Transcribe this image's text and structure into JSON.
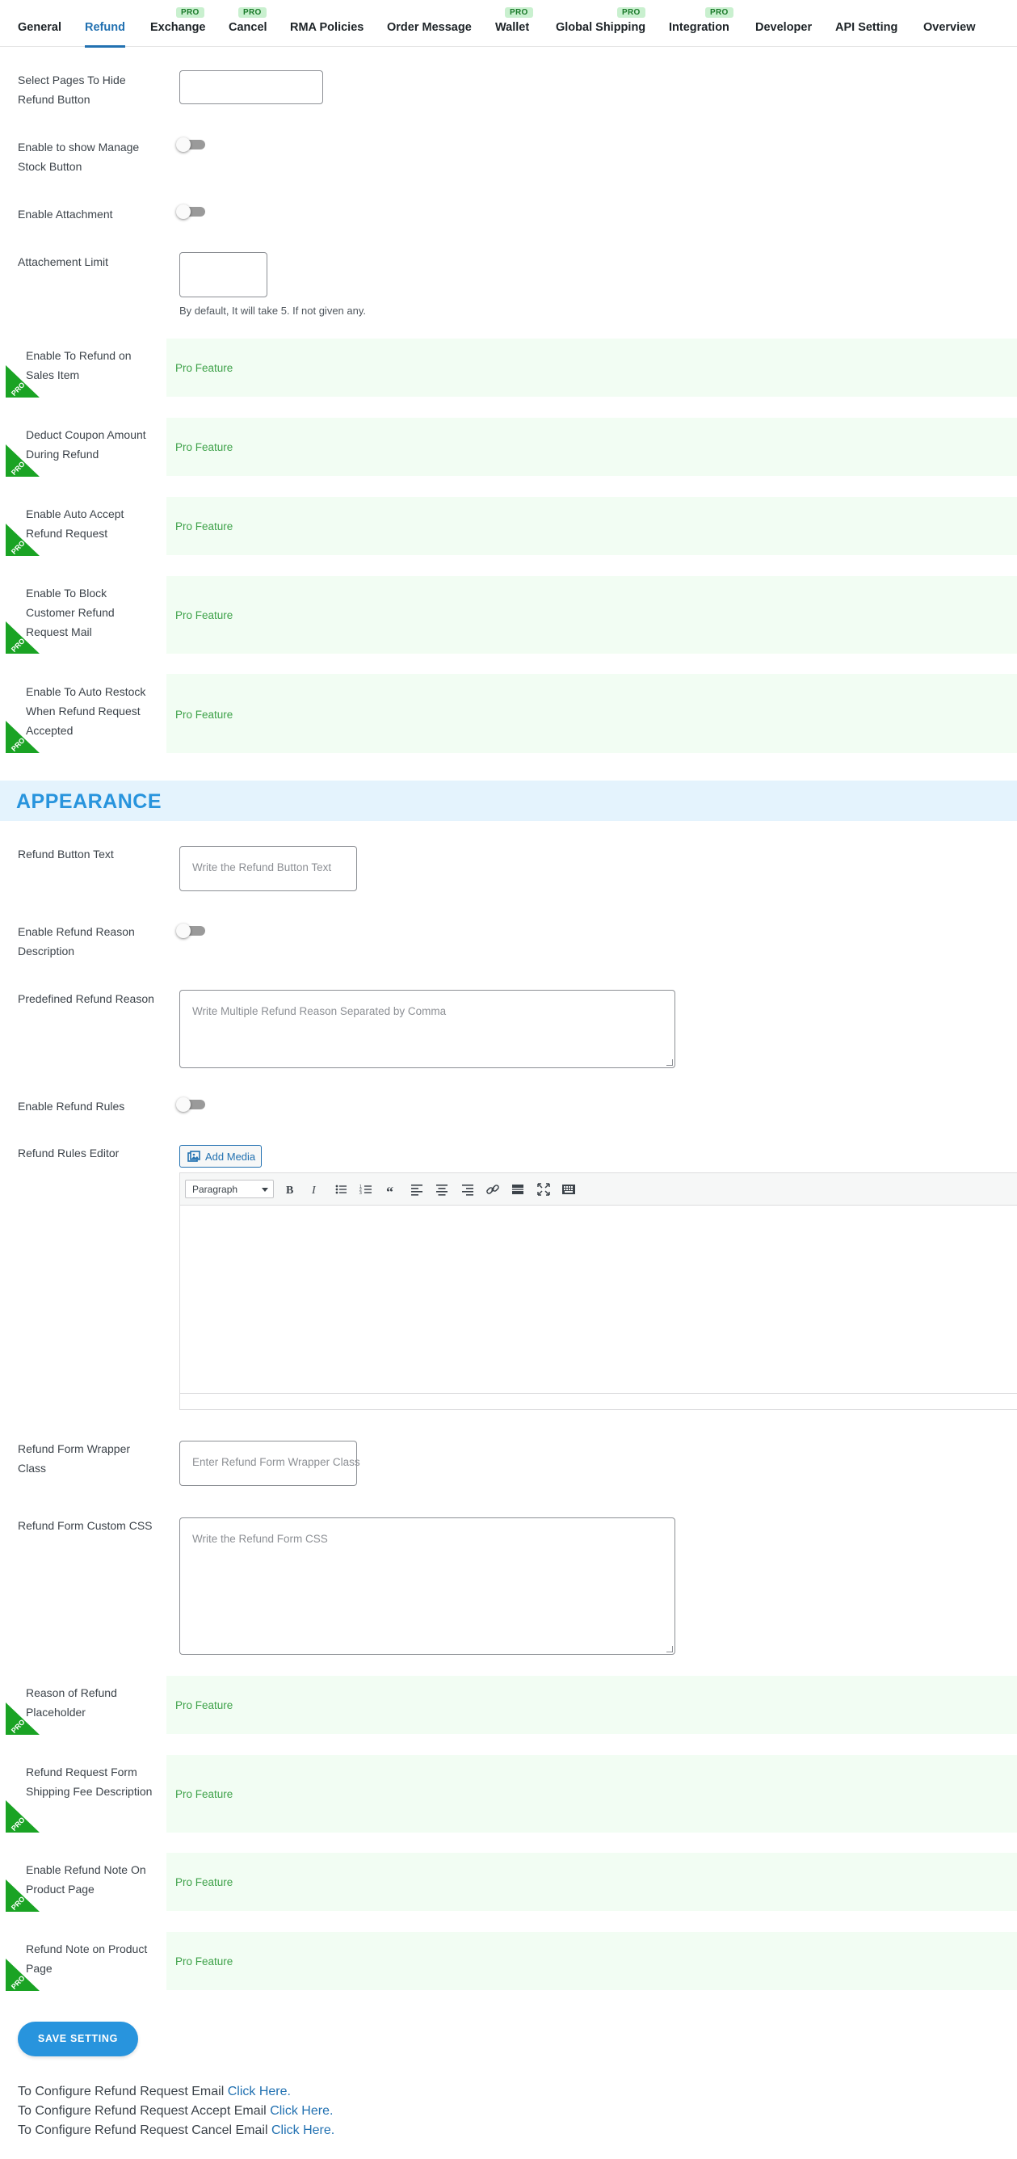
{
  "nav": {
    "tabs": [
      {
        "label": "General",
        "pro": false
      },
      {
        "label": "Refund",
        "pro": false,
        "active": true
      },
      {
        "label": "Exchange",
        "pro": true
      },
      {
        "label": "Cancel",
        "pro": true
      },
      {
        "label": "RMA Policies",
        "pro": false
      },
      {
        "label": "Order Message",
        "pro": false
      },
      {
        "label": "Wallet",
        "pro": true
      },
      {
        "label": "Global Shipping",
        "pro": true
      },
      {
        "label": "Integration",
        "pro": true
      },
      {
        "label": "Developer",
        "pro": false
      },
      {
        "label": "API Setting",
        "pro": false
      },
      {
        "label": "Overview",
        "pro": false
      }
    ],
    "pro_badge": "PRO",
    "active_color": "#2271b1"
  },
  "settings": {
    "hide_pages_label": "Select Pages To Hide Refund Button",
    "manage_stock_label": "Enable to show Manage Stock Button",
    "attachment_label": "Enable Attachment",
    "attachment_limit_label": "Attachement Limit",
    "attachment_limit_help": "By default, It will take 5. If not given any.",
    "pro_rows": [
      {
        "label": "Enable To Refund on Sales Item",
        "value": "Pro Feature"
      },
      {
        "label": "Deduct Coupon Amount During Refund",
        "value": "Pro Feature"
      },
      {
        "label": "Enable Auto Accept Refund Request",
        "value": "Pro Feature"
      },
      {
        "label": "Enable To Block Customer Refund Request Mail",
        "value": "Pro Feature"
      },
      {
        "label": "Enable To Auto Restock When Refund Request Accepted",
        "value": "Pro Feature"
      }
    ]
  },
  "appearance": {
    "heading": "APPEARANCE",
    "heading_color": "#2894dd",
    "button_text_label": "Refund Button Text",
    "button_text_placeholder": "Write the Refund Button Text",
    "reason_desc_label": "Enable Refund Reason Description",
    "predefined_label": "Predefined Refund Reason",
    "predefined_placeholder": "Write Multiple Refund Reason Separated by Comma",
    "rules_label": "Enable Refund Rules",
    "editor_label": "Refund Rules Editor",
    "add_media": "Add Media",
    "format_value": "Paragraph",
    "toolbar_icons": [
      "bold-icon",
      "italic-icon",
      "bullet-list-icon",
      "numbered-list-icon",
      "blockquote-icon",
      "align-left-icon",
      "align-center-icon",
      "align-right-icon",
      "link-icon",
      "read-more-icon",
      "fullscreen-icon",
      "toolbar-toggle-icon"
    ],
    "wrapper_label": "Refund Form Wrapper Class",
    "wrapper_placeholder": "Enter Refund Form Wrapper Class",
    "css_label": "Refund Form Custom CSS",
    "css_placeholder": "Write the Refund Form CSS",
    "pro_rows": [
      {
        "label": "Reason of Refund Placeholder",
        "value": "Pro Feature"
      },
      {
        "label": "Refund Request Form Shipping Fee Description",
        "value": "Pro Feature"
      },
      {
        "label": "Enable Refund Note On Product Page",
        "value": "Pro Feature"
      },
      {
        "label": "Refund Note on Product Page",
        "value": "Pro Feature"
      }
    ]
  },
  "save_button": "SAVE SETTING",
  "save_color": "#2894dd",
  "pro_feature_color": "#3fa24a",
  "pro_corner_color": "#1aa324",
  "config_links": [
    {
      "text": "To Configure Refund Request Email",
      "link": "Click Here."
    },
    {
      "text": "To Configure Refund Request Accept Email",
      "link": "Click Here."
    },
    {
      "text": "To Configure Refund Request Cancel Email",
      "link": "Click Here."
    }
  ]
}
